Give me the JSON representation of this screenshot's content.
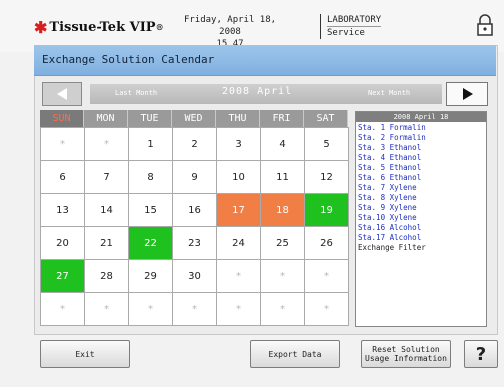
{
  "header": {
    "brand": "Tissue-Tek VIP",
    "date": "Friday, April 18, 2008",
    "time": "15 47",
    "department": "LABORATORY",
    "role": "Service"
  },
  "title": "Exchange Solution Calendar",
  "nav": {
    "last_month": "Last Month",
    "next_month": "Next Month",
    "current": "2008  April"
  },
  "weekdays": [
    "SUN",
    "MON",
    "TUE",
    "WED",
    "THU",
    "FRI",
    "SAT"
  ],
  "days": [
    {
      "text": "*",
      "state": "empty"
    },
    {
      "text": "*",
      "state": "empty"
    },
    {
      "text": "1",
      "state": ""
    },
    {
      "text": "2",
      "state": ""
    },
    {
      "text": "3",
      "state": ""
    },
    {
      "text": "4",
      "state": ""
    },
    {
      "text": "5",
      "state": ""
    },
    {
      "text": "6",
      "state": ""
    },
    {
      "text": "7",
      "state": ""
    },
    {
      "text": "8",
      "state": ""
    },
    {
      "text": "9",
      "state": ""
    },
    {
      "text": "10",
      "state": ""
    },
    {
      "text": "11",
      "state": ""
    },
    {
      "text": "12",
      "state": ""
    },
    {
      "text": "13",
      "state": ""
    },
    {
      "text": "14",
      "state": ""
    },
    {
      "text": "15",
      "state": ""
    },
    {
      "text": "16",
      "state": ""
    },
    {
      "text": "17",
      "state": "orange"
    },
    {
      "text": "18",
      "state": "orange"
    },
    {
      "text": "19",
      "state": "green"
    },
    {
      "text": "20",
      "state": ""
    },
    {
      "text": "21",
      "state": ""
    },
    {
      "text": "22",
      "state": "green"
    },
    {
      "text": "23",
      "state": ""
    },
    {
      "text": "24",
      "state": ""
    },
    {
      "text": "25",
      "state": ""
    },
    {
      "text": "26",
      "state": ""
    },
    {
      "text": "27",
      "state": "green"
    },
    {
      "text": "28",
      "state": ""
    },
    {
      "text": "29",
      "state": ""
    },
    {
      "text": "30",
      "state": ""
    },
    {
      "text": "*",
      "state": "empty"
    },
    {
      "text": "*",
      "state": "empty"
    },
    {
      "text": "*",
      "state": "empty"
    },
    {
      "text": "*",
      "state": "empty"
    },
    {
      "text": "*",
      "state": "empty"
    },
    {
      "text": "*",
      "state": "empty"
    },
    {
      "text": "*",
      "state": "empty"
    },
    {
      "text": "*",
      "state": "empty"
    },
    {
      "text": "*",
      "state": "empty"
    },
    {
      "text": "*",
      "state": "empty"
    }
  ],
  "list": {
    "header": "2008  April  18",
    "items": [
      "Sta. 1 Formalin",
      "Sta. 2 Formalin",
      "Sta. 3 Ethanol",
      "Sta. 4 Ethanol",
      "Sta. 5 Ethanol",
      "Sta. 6 Ethanol",
      "Sta. 7 Xylene",
      "Sta. 8 Xylene",
      "Sta. 9 Xylene",
      "Sta.10 Xylene",
      "Sta.16 Alcohol",
      "Sta.17 Alcohol"
    ],
    "extra": "Exchange Filter"
  },
  "buttons": {
    "exit": "Exit",
    "export": "Export Data",
    "reset": "Reset Solution\nUsage Information",
    "help": "?"
  }
}
